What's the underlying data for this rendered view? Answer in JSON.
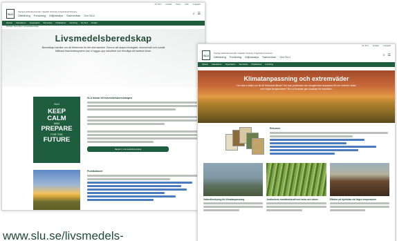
{
  "left": {
    "util_links": [
      "Om SLU",
      "Kontakt",
      "Press",
      "Jobb",
      "Lediga jobb",
      "In English"
    ],
    "org": "Sveriges lantbruksuniversitet / Swedish University of Agricultural Sciences",
    "nav": [
      "Utbildning",
      "Forskning",
      "Miljöanalys",
      "Samverkan",
      "Om SLU"
    ],
    "subnav": [
      "Nyheter",
      "Kalendarium",
      "Organisation",
      "Samverkan",
      "Publikationer",
      "Forskning",
      "Om SLU",
      "Kontakt"
    ],
    "crumb": "Startsida / Samverkan / Livsmedelsberedskap",
    "hero_title": "Livsmedelsberedskap",
    "hero_text": "Beredskap handlar om att förbereda för det oförutsedda. Genom att skapa ekologiskt, ekonomiskt och socialt hållbara livsmedelssystem kan vi bygga upp robusthet och förmåga att hantera kriser.",
    "poster": {
      "mini": "SLU",
      "big1": "KEEP",
      "big2": "CALM",
      "and": "AND",
      "big3": "PREPARE",
      "small": "FOR THE",
      "big4": "FUTURE"
    },
    "article1_title": "SLU bidrar till livsmedelsberedskapen",
    "article1_button": "Rapport: Livsmedelsberedskap",
    "article2_title": "Publikationer"
  },
  "right": {
    "nav": [
      "Utbildning",
      "Forskning",
      "Miljöanalys",
      "Samverkan",
      "Om SLU"
    ],
    "hero_title": "Klimatanpassning och extremväder",
    "hero_text": "Hur ska vi ställa om till ett förändrat klimat? Hur kan jordbruket och skogsbruket anpassas till mer extremt väder och högre temperaturer? SLU:s forskare ger kunskap för framtiden.",
    "resources_title": "Resurser",
    "cards": [
      {
        "title": "Vattenförsörjning för klimatanpassning"
      },
      {
        "title": "Jordbrukets motståndskraft mot torka och värme"
      },
      {
        "title": "Effekter på djurhälsa vid högre temperaturer"
      }
    ]
  },
  "footer_url": "www.slu.se/livsmedels-",
  "colors": {
    "brand": "#1f5d3f",
    "link": "#4a7bbf"
  }
}
